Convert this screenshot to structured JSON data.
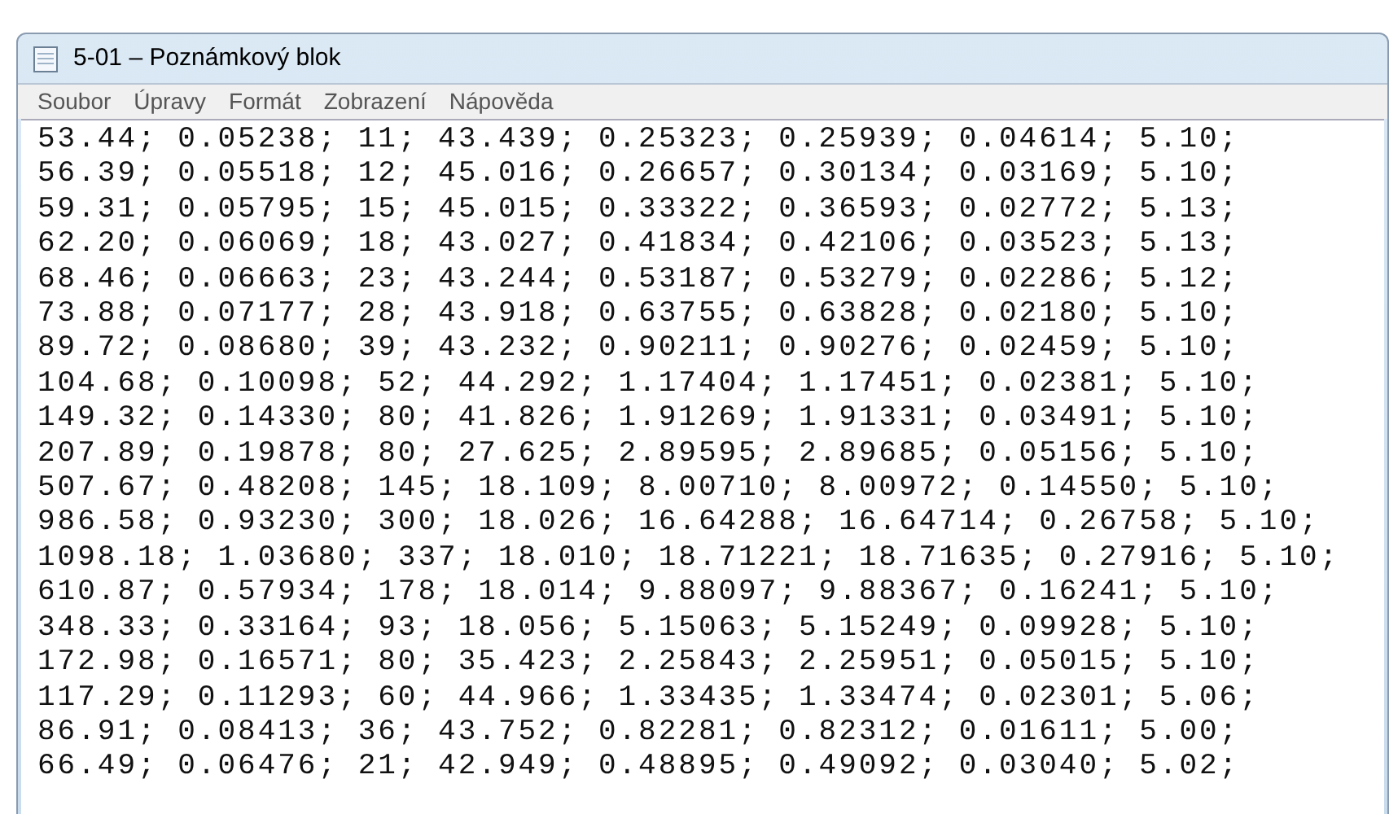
{
  "window": {
    "title": "5-01 – Poznámkový blok"
  },
  "menu": [
    "Soubor",
    "Úpravy",
    "Formát",
    "Zobrazení",
    "Nápověda"
  ],
  "lines": [
    "53.44; 0.05238; 11; 43.439; 0.25323; 0.25939; 0.04614; 5.10;",
    "56.39; 0.05518; 12; 45.016; 0.26657; 0.30134; 0.03169; 5.10;",
    "59.31; 0.05795; 15; 45.015; 0.33322; 0.36593; 0.02772; 5.13;",
    "62.20; 0.06069; 18; 43.027; 0.41834; 0.42106; 0.03523; 5.13;",
    "68.46; 0.06663; 23; 43.244; 0.53187; 0.53279; 0.02286; 5.12;",
    "73.88; 0.07177; 28; 43.918; 0.63755; 0.63828; 0.02180; 5.10;",
    "89.72; 0.08680; 39; 43.232; 0.90211; 0.90276; 0.02459; 5.10;",
    "104.68; 0.10098; 52; 44.292; 1.17404; 1.17451; 0.02381; 5.10;",
    "149.32; 0.14330; 80; 41.826; 1.91269; 1.91331; 0.03491; 5.10;",
    "207.89; 0.19878; 80; 27.625; 2.89595; 2.89685; 0.05156; 5.10;",
    "507.67; 0.48208; 145; 18.109; 8.00710; 8.00972; 0.14550; 5.10;",
    "986.58; 0.93230; 300; 18.026; 16.64288; 16.64714; 0.26758; 5.10;",
    "1098.18; 1.03680; 337; 18.010; 18.71221; 18.71635; 0.27916; 5.10;",
    "610.87; 0.57934; 178; 18.014; 9.88097; 9.88367; 0.16241; 5.10;",
    "348.33; 0.33164; 93; 18.056; 5.15063; 5.15249; 0.09928; 5.10;",
    "172.98; 0.16571; 80; 35.423; 2.25843; 2.25951; 0.05015; 5.10;",
    "117.29; 0.11293; 60; 44.966; 1.33435; 1.33474; 0.02301; 5.06;",
    "86.91; 0.08413; 36; 43.752; 0.82281; 0.82312; 0.01611; 5.00;",
    "66.49; 0.06476; 21; 42.949; 0.48895; 0.49092; 0.03040; 5.02;"
  ]
}
